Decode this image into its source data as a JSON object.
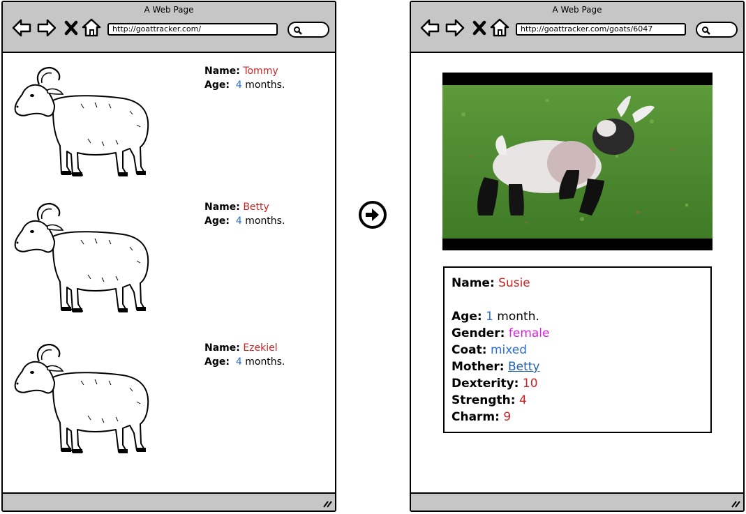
{
  "left_window": {
    "title": "A Web Page",
    "url": "http://goattracker.com/",
    "goats": [
      {
        "name_label": "Name:",
        "name": "Tommy",
        "age_label": "Age:",
        "age": "4",
        "age_unit": "months."
      },
      {
        "name_label": "Name:",
        "name": "Betty",
        "age_label": "Age:",
        "age": "4",
        "age_unit": "months."
      },
      {
        "name_label": "Name:",
        "name": "Ezekiel",
        "age_label": "Age:",
        "age": "4",
        "age_unit": "months."
      }
    ]
  },
  "right_window": {
    "title": "A Web Page",
    "url": "http://goattracker.com/goats/6047",
    "details": {
      "name_label": "Name:",
      "name": "Susie",
      "age_label": "Age:",
      "age": "1",
      "age_unit": "month.",
      "gender_label": "Gender:",
      "gender": "female",
      "coat_label": "Coat:",
      "coat": "mixed",
      "mother_label": "Mother:",
      "mother": "Betty",
      "dexterity_label": "Dexterity:",
      "dexterity": "10",
      "strength_label": "Strength:",
      "strength": "4",
      "charm_label": "Charm:",
      "charm": "9"
    }
  },
  "icons": {
    "back": "back-arrow-icon",
    "forward": "forward-arrow-icon",
    "stop": "close-icon",
    "home": "home-icon",
    "search": "search-icon",
    "transition": "circle-arrow-right-icon",
    "resize": "resize-grip-icon"
  },
  "colors": {
    "chrome": "#c6c6c6",
    "name_red": "#cc2222",
    "value_blue": "#2a6fd6",
    "gender_magenta": "#dd1fdd",
    "link_blue": "#1f5fb3"
  }
}
